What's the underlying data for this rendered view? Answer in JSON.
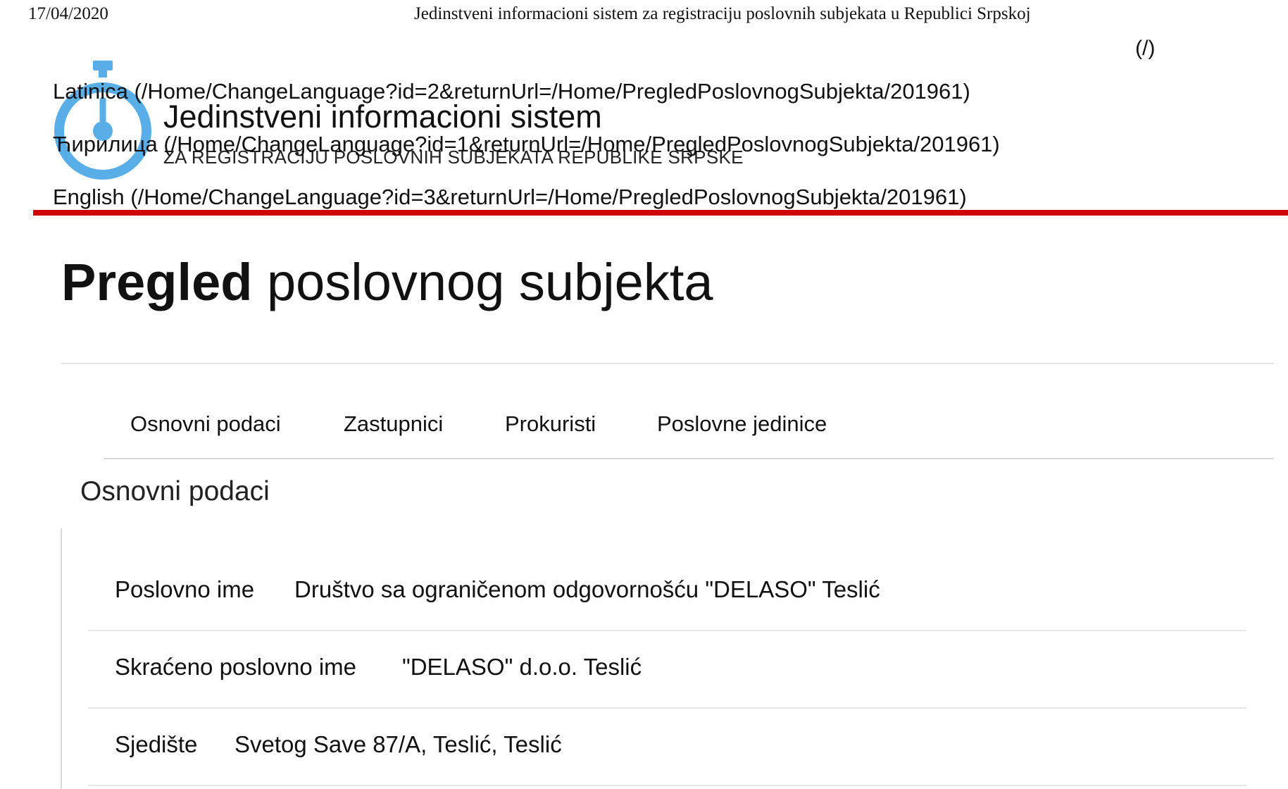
{
  "print_header": {
    "date": "17/04/2020",
    "title": "Jedinstveni informacioni sistem za registraciju poslovnih subjekata u Republici Srpskoj"
  },
  "home_link": "(/)",
  "languages": [
    {
      "label": "Latinica (/Home/ChangeLanguage?id=2&returnUrl=/Home/PregledPoslovnogSubjekta/201961)"
    },
    {
      "label": "Ћирилица (/Home/ChangeLanguage?id=1&returnUrl=/Home/PregledPoslovnogSubjekta/201961)"
    },
    {
      "label": "English (/Home/ChangeLanguage?id=3&returnUrl=/Home/PregledPoslovnogSubjekta/201961)"
    }
  ],
  "brand": {
    "title": "Jedinstveni informacioni sistem",
    "subtitle": "ZA REGISTRACIJU POSLOVNIH SUBJEKATA REPUBLIKE SRPSKE",
    "logo_icon": "stopwatch-icon",
    "logo_color": "#5aaee8"
  },
  "accent_color": "#d00000",
  "page_title": {
    "bold": "Pregled",
    "rest": " poslovnog subjekta"
  },
  "tabs": [
    {
      "label": "Osnovni podaci"
    },
    {
      "label": "Zastupnici"
    },
    {
      "label": "Prokuristi"
    },
    {
      "label": "Poslovne jedinice"
    }
  ],
  "section_title": "Osnovni podaci",
  "details": [
    {
      "label": "Poslovno ime",
      "value": "Društvo sa ograničenom odgovornošću \"DELASO\" Teslić"
    },
    {
      "label": "Skraćeno poslovno ime",
      "value": "\"DELASO\" d.o.o. Teslić"
    },
    {
      "label": "Sjedište",
      "value": "Svetog Save 87/A, Teslić, Teslić"
    }
  ]
}
